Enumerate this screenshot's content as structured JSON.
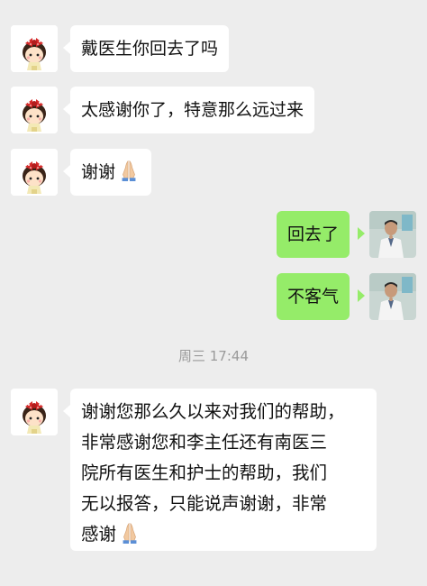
{
  "messages": [
    {
      "side": "in",
      "text": "戴医生你回去了吗"
    },
    {
      "side": "in",
      "text": "太感谢你了，特意那么远过来"
    },
    {
      "side": "in",
      "text": "谢谢",
      "emoji": "folded-hands"
    },
    {
      "side": "out",
      "text": "回去了"
    },
    {
      "side": "out",
      "text": "不客气"
    }
  ],
  "timestamp": "周三 17:44",
  "long_message": {
    "side": "in",
    "lines": [
      "谢谢您那么久以来对我们的帮助，",
      "非常感谢您和李主任还有南医三",
      "院所有医生和护士的帮助，我们",
      "无以报答，只能说声谢谢，非常",
      "感谢"
    ],
    "emoji": "folded-hands"
  },
  "colors": {
    "background": "#ededed",
    "incoming_bubble": "#ffffff",
    "outgoing_bubble": "#95ec69",
    "timestamp": "#9a9a9a"
  }
}
